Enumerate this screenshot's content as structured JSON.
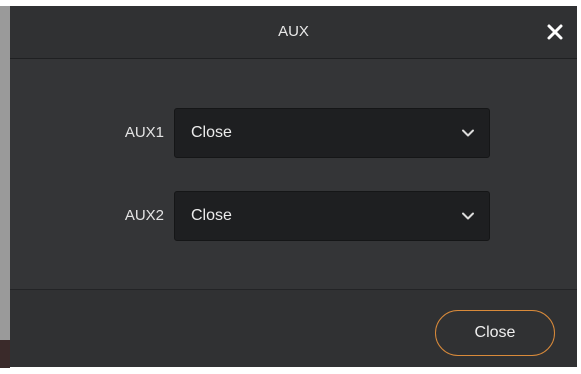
{
  "dialog": {
    "title": "AUX",
    "close_icon": "close-icon"
  },
  "fields": [
    {
      "label": "AUX1",
      "value": "Close",
      "icon": "chevron-down-icon"
    },
    {
      "label": "AUX2",
      "value": "Close",
      "icon": "chevron-down-icon"
    }
  ],
  "footer": {
    "close_label": "Close",
    "accent_color": "#d98a3a"
  }
}
